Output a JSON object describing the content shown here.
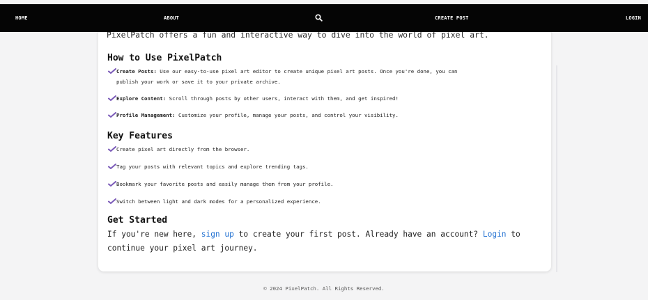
{
  "nav": {
    "home": "HOME",
    "about": "ABOUT",
    "search_icon": "search-icon",
    "create_post": "CREATE POST",
    "login": "LOGIN"
  },
  "content": {
    "intro": "PixelPatch offers a fun and interactive way to dive into the world of pixel art.",
    "how_to_title": "How to Use PixelPatch",
    "how_to_items": [
      {
        "label": "Create Posts:",
        "text": " Use our easy-to-use pixel art editor to create unique pixel art posts. Once you're done, you can",
        "text_cont": "publish your work or save it to your private archive."
      },
      {
        "label": "Explore Content:",
        "text": " Scroll through posts by other users, interact with them, and get inspired!"
      },
      {
        "label": "Profile Management:",
        "text": " Customize your profile, manage your posts, and control your visibility."
      }
    ],
    "key_features_title": "Key Features",
    "key_features": [
      "Create pixel art directly from the browser.",
      "Tag your posts with relevant topics and explore trending tags.",
      "Bookmark your favorite posts and easily manage them from your profile.",
      "Switch between light and dark modes for a personalized experience."
    ],
    "get_started_title": "Get Started",
    "get_started": {
      "part1": "If you're new here, ",
      "signup_link": "sign up",
      "part2": " to create your first post. Already have an account? ",
      "login_link": "Login",
      "part3": " to continue your pixel art journey."
    }
  },
  "footer": {
    "text": "© 2024 PixelPatch. All Rights Reserved."
  },
  "colors": {
    "navbar_bg": "#050505",
    "link": "#1f6fd1",
    "check": "#7a5ab8",
    "page_bg": "#f4f4f5"
  }
}
